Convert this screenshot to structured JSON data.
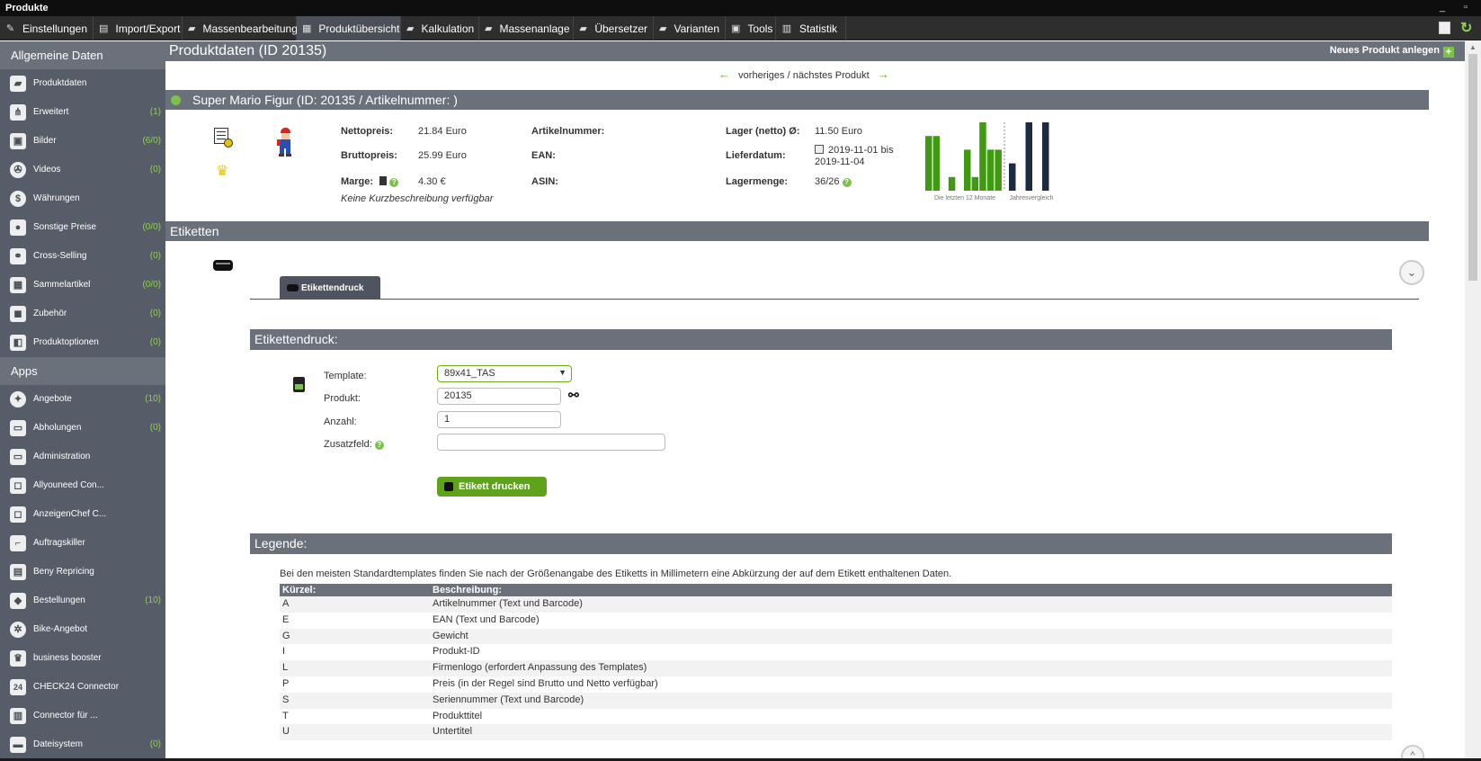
{
  "window": {
    "title": "Produkte"
  },
  "menu": [
    {
      "label": "Einstellungen",
      "icon": "wrench-icon",
      "glyph": "✎"
    },
    {
      "label": "Import/Export",
      "icon": "document-icon",
      "glyph": "▤"
    },
    {
      "label": "Massenbearbeitung",
      "icon": "basket-icon",
      "glyph": "▰"
    },
    {
      "label": "Produktübersicht",
      "icon": "grid-icon",
      "glyph": "▦",
      "active": true
    },
    {
      "label": "Kalkulation",
      "icon": "basket-icon",
      "glyph": "▰"
    },
    {
      "label": "Massenanlage",
      "icon": "basket-icon",
      "glyph": "▰"
    },
    {
      "label": "Übersetzer",
      "icon": "basket-icon",
      "glyph": "▰"
    },
    {
      "label": "Varianten",
      "icon": "basket-icon",
      "glyph": "▰"
    },
    {
      "label": "Tools",
      "icon": "toolbox-icon",
      "glyph": "▣"
    },
    {
      "label": "Statistik",
      "icon": "chart-icon",
      "glyph": "▥"
    }
  ],
  "sidebar": {
    "section1": "Allgemeine Daten",
    "items1": [
      {
        "label": "Produktdaten",
        "count": "",
        "icon": "basket-icon",
        "glyph": "▰"
      },
      {
        "label": "Erweitert",
        "count": "(1)",
        "icon": "hierarchy-icon",
        "glyph": "⋔"
      },
      {
        "label": "Bilder",
        "count": "(6/0)",
        "icon": "image-icon",
        "glyph": "▣"
      },
      {
        "label": "Videos",
        "count": "(0)",
        "icon": "film-reel-icon",
        "glyph": "✇"
      },
      {
        "label": "Währungen",
        "count": "",
        "icon": "dollar-icon",
        "glyph": "$"
      },
      {
        "label": "Sonstige Preise",
        "count": "(0/0)",
        "icon": "user-icon",
        "glyph": "●"
      },
      {
        "label": "Cross-Selling",
        "count": "(0)",
        "icon": "users-icon",
        "glyph": "⚭"
      },
      {
        "label": "Sammelartikel",
        "count": "(0/0)",
        "icon": "boxes-icon",
        "glyph": "▦"
      },
      {
        "label": "Zubehör",
        "count": "(0)",
        "icon": "box-icon",
        "glyph": "◼"
      },
      {
        "label": "Produktoptionen",
        "count": "(0)",
        "icon": "options-icon",
        "glyph": "◧"
      }
    ],
    "section2": "Apps",
    "items2": [
      {
        "label": "Angebote",
        "count": "(10)",
        "icon": "offer-icon",
        "glyph": "✦"
      },
      {
        "label": "Abholungen",
        "count": "(0)",
        "icon": "truck-icon",
        "glyph": "▭"
      },
      {
        "label": "Administration",
        "count": "",
        "icon": "window-icon",
        "glyph": "▭"
      },
      {
        "label": "Allyouneed Con...",
        "count": "",
        "icon": "app-icon",
        "glyph": "◻"
      },
      {
        "label": "AnzeigenChef C...",
        "count": "",
        "icon": "page-icon",
        "glyph": "◻"
      },
      {
        "label": "Auftragskiller",
        "count": "",
        "icon": "pistol-icon",
        "glyph": "⌐"
      },
      {
        "label": "Beny Repricing",
        "count": "",
        "icon": "repricing-icon",
        "glyph": "▤"
      },
      {
        "label": "Bestellungen",
        "count": "(10)",
        "icon": "diamond-icon",
        "glyph": "◆"
      },
      {
        "label": "Bike-Angebot",
        "count": "",
        "icon": "gear-icon",
        "glyph": "✲"
      },
      {
        "label": "business booster",
        "count": "",
        "icon": "trophy-icon",
        "glyph": "♛"
      },
      {
        "label": "CHECK24 Connector",
        "count": "",
        "icon": "check24-icon",
        "glyph": "24"
      },
      {
        "label": "Connector für ...",
        "count": "",
        "icon": "book-icon",
        "glyph": "▥"
      },
      {
        "label": "Dateisystem",
        "count": "(0)",
        "icon": "folder-icon",
        "glyph": "▬"
      }
    ]
  },
  "header": {
    "title": "Produktdaten (ID 20135)",
    "new_product": "Neues Produkt anlegen",
    "new_icon": "+"
  },
  "nav": {
    "prev_arrow": "←",
    "text": "vorheriges / nächstes Produkt",
    "next_arrow": "→"
  },
  "product": {
    "title": "Super Mario Figur (ID: 20135 / Artikelnummer: )",
    "netto_label": "Nettopreis:",
    "netto_value": "21.84 Euro",
    "brutto_label": "Bruttopreis:",
    "brutto_value": "25.99 Euro",
    "marge_label": "Marge:",
    "marge_value": "4.30 €",
    "artnr_label": "Artikelnummer:",
    "ean_label": "EAN:",
    "asin_label": "ASIN:",
    "lager_label": "Lager (netto) Ø:",
    "lager_value": "11.50 Euro",
    "liefer_label": "Lieferdatum:",
    "liefer_value1": "2019-11-01 bis",
    "liefer_value2": "2019-11-04",
    "menge_label": "Lagermenge:",
    "menge_value": "36/26",
    "short_desc": "Keine Kurzbeschreibung verfügbar",
    "qmark": "?"
  },
  "chart_data": {
    "type": "bar",
    "months_label": "Die letzten 12 Monate",
    "year_label": "Jahresvergleich",
    "months_values": [
      4,
      4,
      0,
      1,
      0,
      3,
      1,
      5,
      3,
      3
    ],
    "year_values": [
      2,
      5,
      5
    ],
    "ylim": [
      0,
      5
    ],
    "colors": {
      "months": "#3f9a12",
      "year": "#1c2a44",
      "divider": "#888888"
    }
  },
  "etiketten": {
    "section_title": "Etiketten",
    "tab": "Etikettendruck",
    "collapse_glyph": "⌄",
    "druck_title": "Etikettendruck:",
    "template_label": "Template:",
    "template_value": "89x41_TAS",
    "caret": "▼",
    "produkt_label": "Produkt:",
    "produkt_value": "20135",
    "anzahl_label": "Anzahl:",
    "anzahl_value": "1",
    "zusatz_label": "Zusatzfeld:",
    "zusatz_value": "",
    "print_button": "Etikett drucken",
    "search_glyph": "⚯"
  },
  "legend": {
    "title": "Legende:",
    "intro": "Bei den meisten Standardtemplates finden Sie nach der Größenangabe des Etiketts in Millimetern eine Abkürzung der auf dem Etikett enthaltenen Daten.",
    "col1": "Kürzel:",
    "col2": "Beschreibung:",
    "rows": [
      {
        "k": "A",
        "d": "Artikelnummer (Text und Barcode)"
      },
      {
        "k": "E",
        "d": "EAN (Text und Barcode)"
      },
      {
        "k": "G",
        "d": "Gewicht"
      },
      {
        "k": "I",
        "d": "Produkt-ID"
      },
      {
        "k": "L",
        "d": "Firmenlogo (erfordert Anpassung des Templates)"
      },
      {
        "k": "P",
        "d": "Preis (in der Regel sind Brutto und Netto verfügbar)"
      },
      {
        "k": "S",
        "d": "Seriennummer (Text und Barcode)"
      },
      {
        "k": "T",
        "d": "Produkttitel"
      },
      {
        "k": "U",
        "d": "Untertitel"
      }
    ]
  },
  "colors": {
    "header_bar": "#6b717b",
    "sidebar": "#565d69",
    "accent_green": "#7cc24a",
    "button_green": "#5fa31a"
  }
}
